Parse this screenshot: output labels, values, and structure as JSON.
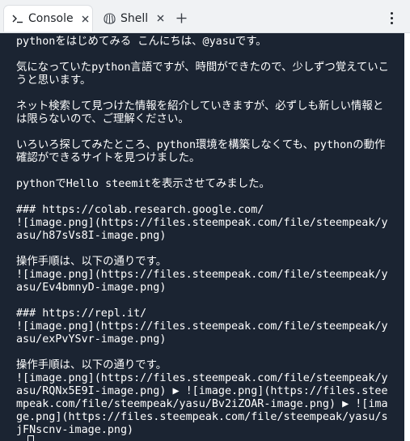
{
  "tabs": [
    {
      "label": "Console",
      "icon": "terminal-prompt-icon",
      "active": true
    },
    {
      "label": "Shell",
      "icon": "shell-icon",
      "active": false
    }
  ],
  "console": {
    "lines": [
      "pythonをはじめてみる こんにちは、@yasuです。",
      "",
      "気になっていたpython言語ですが、時間ができたので、少しずつ覚えていこうと思います。",
      "",
      "ネット検索して見つけた情報を紹介していきますが、必ずしも新しい情報とは限らないので、ご理解ください。",
      "",
      "いろいろ探してみたところ、python環境を構築しなくても、pythonの動作確認ができるサイトを見つけました。",
      "",
      "pythonでHello steemitを表示させてみました。",
      "",
      "### https://colab.research.google.com/",
      "![image.png](https://files.steempeak.com/file/steempeak/yasu/h87sVs8I-image.png)",
      "",
      "操作手順は、以下の通りです。",
      "![image.png](https://files.steempeak.com/file/steempeak/yasu/Ev4bmnyD-image.png)",
      "",
      "### https://repl.it/",
      "![image.png](https://files.steempeak.com/file/steempeak/yasu/exPvYSvr-image.png)",
      "",
      "操作手順は、以下の通りです。",
      "![image.png](https://files.steempeak.com/file/steempeak/yasu/RQNx5E9I-image.png) ▶ ![image.png](https://files.steempeak.com/file/steempeak/yasu/Bv2iZOAR-image.png) ▶ ![image.png](https://files.steempeak.com/file/steempeak/yasu/sjFNscnv-image.png)"
    ]
  },
  "colors": {
    "console_bg": "#1b2432",
    "console_text": "#ffffff",
    "tabbar_bg": "#f0f2f4"
  }
}
